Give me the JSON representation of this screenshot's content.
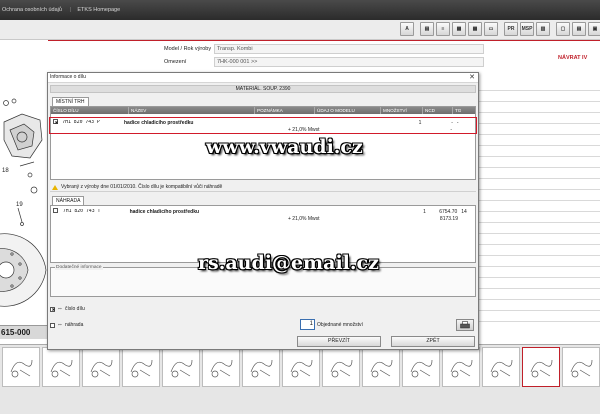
{
  "topbar": {
    "items": [
      "Ochrana osobních údajů",
      "ETKS Homepage"
    ]
  },
  "toolbar": {
    "buttons": [
      {
        "name": "binoculars-icon",
        "glyph": "A"
      },
      {
        "name": "print-preview-icon",
        "glyph": "▤"
      },
      {
        "name": "list-icon",
        "glyph": "≡"
      },
      {
        "name": "table-icon",
        "glyph": "▦"
      },
      {
        "name": "grid-icon",
        "glyph": "▦"
      },
      {
        "name": "car-icon",
        "glyph": "▭"
      },
      {
        "name": "pr-icon",
        "glyph": "PR"
      },
      {
        "name": "msp-icon",
        "glyph": "MSP"
      },
      {
        "name": "chart-icon",
        "glyph": "▥"
      },
      {
        "name": "window-icon",
        "glyph": "▢"
      },
      {
        "name": "doc-icon",
        "glyph": "▤"
      },
      {
        "name": "pdf-icon",
        "glyph": "▣"
      },
      {
        "name": "page-icon",
        "glyph": "▤"
      }
    ]
  },
  "info": {
    "model_label": "Model / Rok výroby",
    "model_value": "Transp. Kombi",
    "omezeni_label": "Omezení",
    "omezeni_value": "7HK-000 001 >>",
    "navrat_label": "NÁVRAT IV"
  },
  "diagram": {
    "label_19": "19",
    "label_18": "18",
    "part_number": "615-000"
  },
  "dialog": {
    "title": "Informace o dílu",
    "caption": "MATERIÁL. SOUP. 2390",
    "tab_top": "MÍSTNÍ TRH",
    "grid_headers": [
      "ČÍSLO DÍLU",
      "NÁZEV",
      "POZNÁMKA",
      "ÚDAJ O MODELU",
      "MNOŽSTVÍ",
      "NCD",
      "TG"
    ],
    "row1": {
      "part_no": "7H1 820 743 P",
      "name": "hadice chladicího prostředku",
      "qty": "1",
      "ncd": "-",
      "tg": "-",
      "vat": "+ 21,0% Mwst",
      "ncd2": "-"
    },
    "warning": "Vybraný z výroby dne 01/01/2010. Číslo dílu je kompatibilní vůči náhradě",
    "tab_bottom": "NÁHRADA",
    "row2": {
      "part_no": "7H1 820 743 T",
      "name": "hadice chladicího prostředku",
      "qty": "1",
      "ncd": "6754.70",
      "tg": "14",
      "vat": "+ 21,0% Mwst",
      "ncd2": "8173.19"
    },
    "add_info_label": "Dodatečné informace",
    "opt_part_label": "číslo dílu",
    "opt_replace_label": "náhrada",
    "qty_value": "1",
    "qty_label": "Objednané množství",
    "btn_take": "PŘEVZÍT",
    "btn_back": "ZPĚT"
  },
  "watermarks": {
    "site": "www.vwaudi.cz",
    "email": "rs.audi@email.cz"
  },
  "colors": {
    "accent_red": "#c0202a",
    "selection_red": "#d11a2a",
    "header_grey": "#7a7a7a",
    "qty_border": "#3a6fb0"
  }
}
